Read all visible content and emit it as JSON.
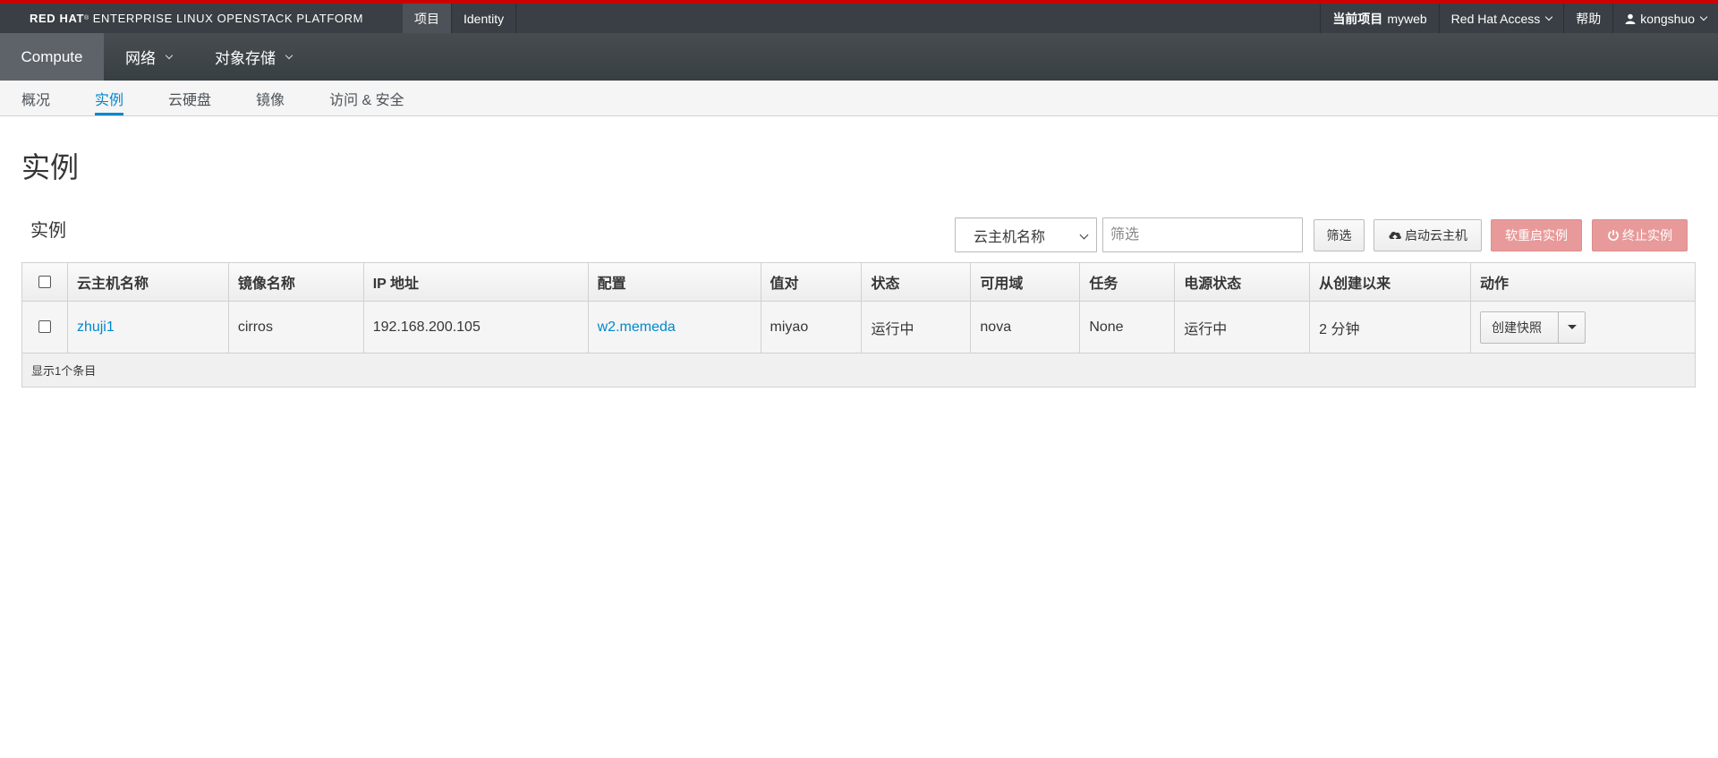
{
  "masthead": {
    "brand_a": "RED HAT",
    "brand_reg": "®",
    "brand_b": "ENTERPRISE LINUX OPENSTACK PLATFORM",
    "tabs": [
      {
        "label": "项目",
        "active": true
      },
      {
        "label": "Identity",
        "active": false
      }
    ],
    "current_project_label": "当前项目",
    "current_project_value": "myweb",
    "redhat_access": "Red Hat Access",
    "help": "帮助",
    "user": "kongshuo",
    "accent_color": "#cc0000"
  },
  "primary_nav": {
    "items": [
      {
        "label": "Compute",
        "active": true
      },
      {
        "label": "网络",
        "dropdown": true
      },
      {
        "label": "对象存储",
        "dropdown": true
      }
    ]
  },
  "secondary_nav": {
    "items": [
      {
        "label": "概况",
        "active": false
      },
      {
        "label": "实例",
        "active": true
      },
      {
        "label": "云硬盘",
        "active": false
      },
      {
        "label": "镜像",
        "active": false
      },
      {
        "label": "访问 & 安全",
        "active": false
      }
    ],
    "active_color": "#0088ce"
  },
  "page": {
    "title": "实例",
    "table_title": "实例"
  },
  "toolbar": {
    "filter_field": "云主机名称",
    "filter_placeholder": "筛选",
    "filter_button": "筛选",
    "launch_button": "启动云主机",
    "launch_icon": "cloud-upload-icon",
    "soft_reboot_button": "软重启实例",
    "terminate_button": "终止实例",
    "terminate_icon": "power-icon"
  },
  "table": {
    "columns": [
      "云主机名称",
      "镜像名称",
      "IP 地址",
      "配置",
      "值对",
      "状态",
      "可用域",
      "任务",
      "电源状态",
      "从创建以来",
      "动作"
    ],
    "rows": [
      {
        "name": "zhuji1",
        "image": "cirros",
        "ip": "192.168.200.105",
        "flavor": "w2.memeda",
        "keypair": "miyao",
        "status": "运行中",
        "zone": "nova",
        "task": "None",
        "power": "运行中",
        "age": "2 分钟",
        "action": "创建快照"
      }
    ],
    "footer": "显示1个条目"
  }
}
